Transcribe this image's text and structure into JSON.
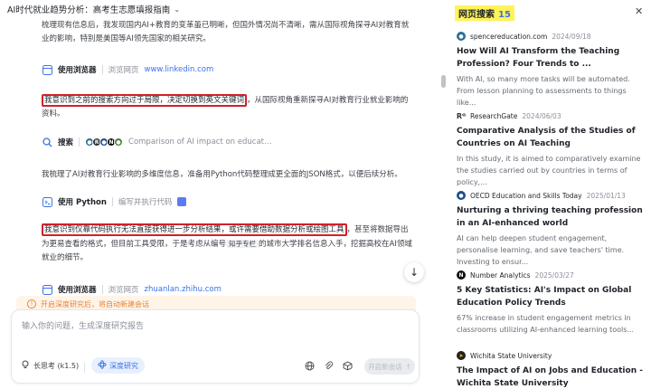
{
  "window": {
    "title": "AI时代就业趋势分析：高考生志愿填报指南"
  },
  "messages": {
    "p1": "梳理现有信息后，我发现国内AI+教育的变革虽已明晰，但国外情况尚不清晰，需从国际视角探寻AI对教育就业的影响，特别是美国等AI领先国家的相关研究。",
    "p2_highlight": "我意识到之前的搜索方向过于局限，决定切换到英文关键词",
    "p2_rest": "，从国际视角重新探寻AI对教育行业就业影响的资料。",
    "p3": "我梳理了AI对教育行业影响的多维度信息，准备用Python代码整理成更全面的JSON格式，以便后续分析。",
    "p4_highlight": "我意识到仅靠代码执行无法直接获得进一步分析结果，或许需要借助数据分析或绘图工具",
    "p4_a": "，甚至将数据导出为更易查看的格式，但目前工具受限，于是考虑从编号",
    "p4_kw": "知乎专栏",
    "p4_b": "的城市大学排名信息入手，挖掘高校在AI领域就业的细节。"
  },
  "tools": {
    "t1": {
      "name": "使用浏览器",
      "desc": "浏览网页",
      "link": "www.linkedin.com"
    },
    "t2": {
      "name": "搜索",
      "query": "Comparison of AI impact on educatio..."
    },
    "t3": {
      "name": "使用 Python",
      "desc": "编写并执行代码"
    },
    "t4": {
      "name": "使用浏览器",
      "desc": "浏览网页",
      "link": "zhuanlan.zhihu.com"
    }
  },
  "banner": {
    "text": "开启深度研究后，将自动新建会话"
  },
  "composer": {
    "placeholder": "输入你的问题，生成深度研究报告",
    "mode": "长思考 (k1.5)",
    "deep": "深度研究",
    "send": "开启新会话"
  },
  "panel": {
    "title": "网页搜索",
    "count": "15",
    "results": [
      {
        "source": "spencereducation.com",
        "date": "2024/09/18",
        "title": "How Will AI Transform the Teaching Profession? Four Trends to ...",
        "snippet": "With AI, so many more tasks will be automated. From lesson planning to assessments to things like...",
        "fav_color": "#2a6f97"
      },
      {
        "source": "ResearchGate",
        "date": "2024/06/03",
        "title": "Comparative Analysis of the Studies of Countries on AI Teaching",
        "snippet": "In this study, it is aimed to comparatively examine the studies carried out by countries in terms of policy,...",
        "fav_color": "#333333"
      },
      {
        "source": "OECD Education and Skills Today",
        "date": "2025/01/13",
        "title": "Nurturing a thriving teaching profession in an AI-enhanced world",
        "snippet": "AI can help deepen student engagement, personalise learning, and save teachers' time. Investing to ensur...",
        "fav_color": "#1f4e8c"
      },
      {
        "source": "Number Analytics",
        "date": "2025/03/27",
        "title": "5 Key Statistics: AI's Impact on Global Education Policy Trends",
        "snippet": "67% increase in student engagement metrics in classrooms utilizing AI-enhanced learning tools...",
        "fav_color": "#111111"
      },
      {
        "source": "Wichita State University",
        "date": "",
        "title": "The Impact of AI on Jobs and Education - Wichita State University",
        "snippet": "",
        "fav_color": "#222222"
      }
    ]
  },
  "colors": {
    "accent": "#3b73e6",
    "highlight_box": "#d0212a",
    "panel_title_bg": "#fff35a",
    "banner_text": "#e6833a"
  }
}
